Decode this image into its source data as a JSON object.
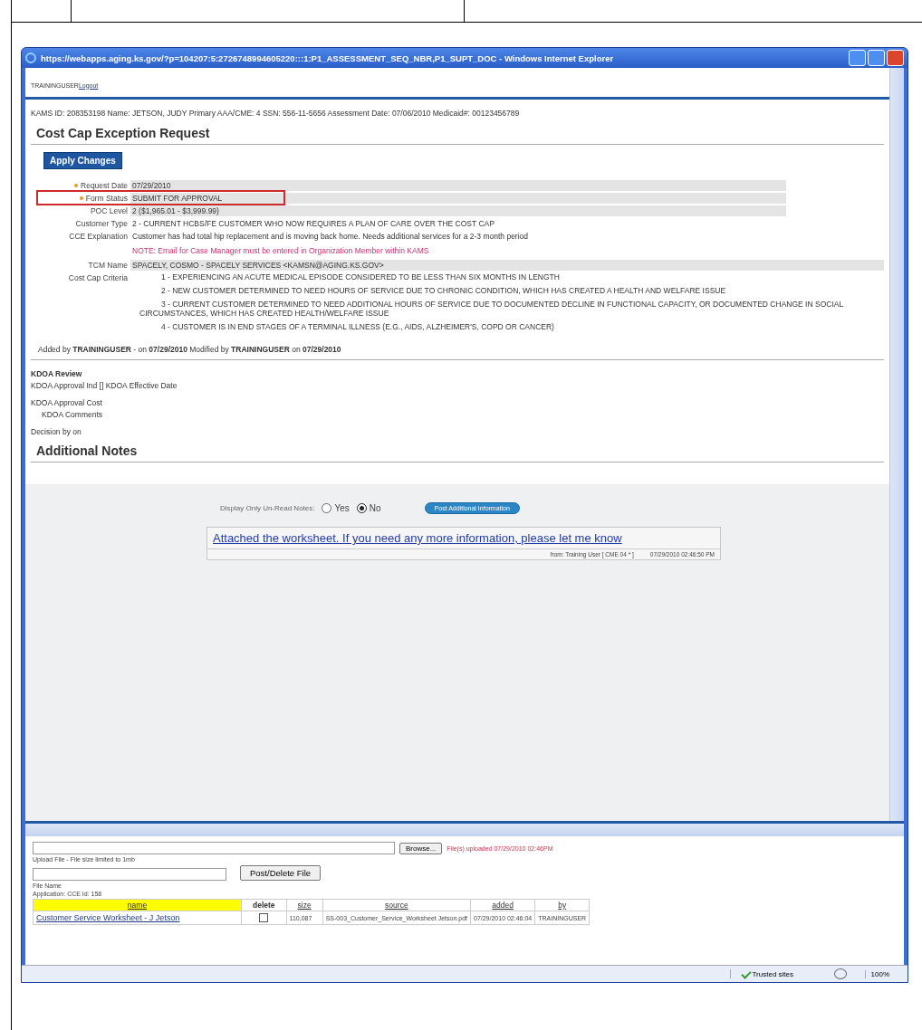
{
  "window": {
    "title": "https://webapps.aging.ks.gov/?p=104207:5:2726748994605220:::1:P1_ASSESSMENT_SEQ_NBR,P1_SUPT_DOC - Windows Internet Explorer"
  },
  "user_bar": {
    "user": "TRAININGUSER",
    "logout": "Logout"
  },
  "header_line": "KAMS ID: 208353198 Name: JETSON, JUDY Primary AAA/CME: 4 SSN: 556-11-5656 Assessment Date: 07/06/2010 Medicaid#: 00123456789",
  "form": {
    "title": "Cost Cap Exception Request",
    "apply_button": "Apply Changes",
    "fields": [
      {
        "kind": "shaded",
        "label": "Request Date",
        "value": "07/29/2010",
        "required": true,
        "highlighted": false
      },
      {
        "kind": "shaded",
        "label": "Form Status",
        "value": "SUBMIT FOR APPROVAL",
        "required": true,
        "highlighted": true
      },
      {
        "kind": "shaded",
        "label": "POC Level",
        "value": "2 ($1,965.01 - $3,999.99)",
        "required": false,
        "highlighted": false
      },
      {
        "kind": "plain",
        "label": "Customer Type",
        "value": "2 - CURRENT HCBS/FE CUSTOMER WHO NOW REQUIRES A PLAN OF CARE OVER THE COST CAP",
        "required": false,
        "highlighted": false
      },
      {
        "kind": "plain",
        "label": "CCE Explanation",
        "value": "Customer has had total hip replacement and is moving back home. Needs additional services for a 2-3 month period",
        "required": false,
        "highlighted": false
      },
      {
        "kind": "note",
        "value": "NOTE: Email for Case Manager must be entered in Organization Member within KAMS"
      },
      {
        "kind": "wide",
        "label": "TCM Name",
        "value": "SPACELY, COSMO - SPACELY SERVICES <KAMSN@AGING.KS.GOV>",
        "required": false,
        "highlighted": false
      }
    ],
    "criteria": {
      "label": "Cost Cap Criteria",
      "items": [
        "1 - EXPERIENCING AN ACUTE MEDICAL EPISODE CONSIDERED TO BE LESS THAN SIX MONTHS IN LENGTH",
        "2 - NEW CUSTOMER DETERMINED TO NEED HOURS OF SERVICE DUE TO CHRONIC CONDITION, WHICH HAS CREATED A HEALTH AND WELFARE ISSUE",
        "3 - CURRENT CUSTOMER DETERMINED TO NEED ADDITIONAL HOURS OF SERVICE DUE TO DOCUMENTED DECLINE IN FUNCTIONAL CAPACITY, OR DOCUMENTED CHANGE IN SOCIAL CIRCUMSTANCES, WHICH HAS CREATED HEALTH/WELFARE ISSUE",
        "4 - CUSTOMER IS IN END STAGES OF A TERMINAL ILLNESS (E.G., AIDS, ALZHEIMER'S, COPD OR CANCER)"
      ]
    },
    "audit": "Added by **TRAININGUSER** - on **07/29/2010** Modified by **TRAININGUSER** on **07/29/2010**"
  },
  "review": {
    "title": "KDOA Review",
    "lines": [
      "KDOA Approval Ind [] KDOA Effective Date",
      "KDOA Approval Cost",
      "KDOA Comments",
      "Decision by  on"
    ]
  },
  "notes": {
    "title": "Additional Notes",
    "filter_label": "Display Only Un-Read Notes:",
    "options": [
      {
        "label": "Yes",
        "selected": false
      },
      {
        "label": "No",
        "selected": true
      }
    ],
    "post_button": "Post Additional Information",
    "items": [
      {
        "text": "Attached the worksheet. If you need any more information, please let me know",
        "from": "from: Training User [ CME 04 * ]",
        "date": "07/29/2010 02:46:50 PM"
      }
    ]
  },
  "upload": {
    "browse_button": "Browse...",
    "message": "File(s) uploaded 07/29/2010 02:46PM",
    "hint": "Upload File - File size limited to 1mb",
    "post_button": "Post/Delete File",
    "file_name_label": "File Name",
    "app_label": "Application: CCE Id: 158",
    "table": {
      "columns": [
        "name",
        "delete",
        "size",
        "source",
        "added",
        "by"
      ],
      "rows": [
        {
          "name": "Customer Service Worksheet - J Jetson",
          "checked": false,
          "size": "110,087",
          "source": "SS-003_Customer_Service_Worksheet Jetson.pdf",
          "added": "07/29/2010 02:46:04",
          "by": "TRAININGUSER"
        }
      ]
    }
  },
  "status_bar": {
    "zone": "Trusted sites",
    "zoom": "100%"
  }
}
